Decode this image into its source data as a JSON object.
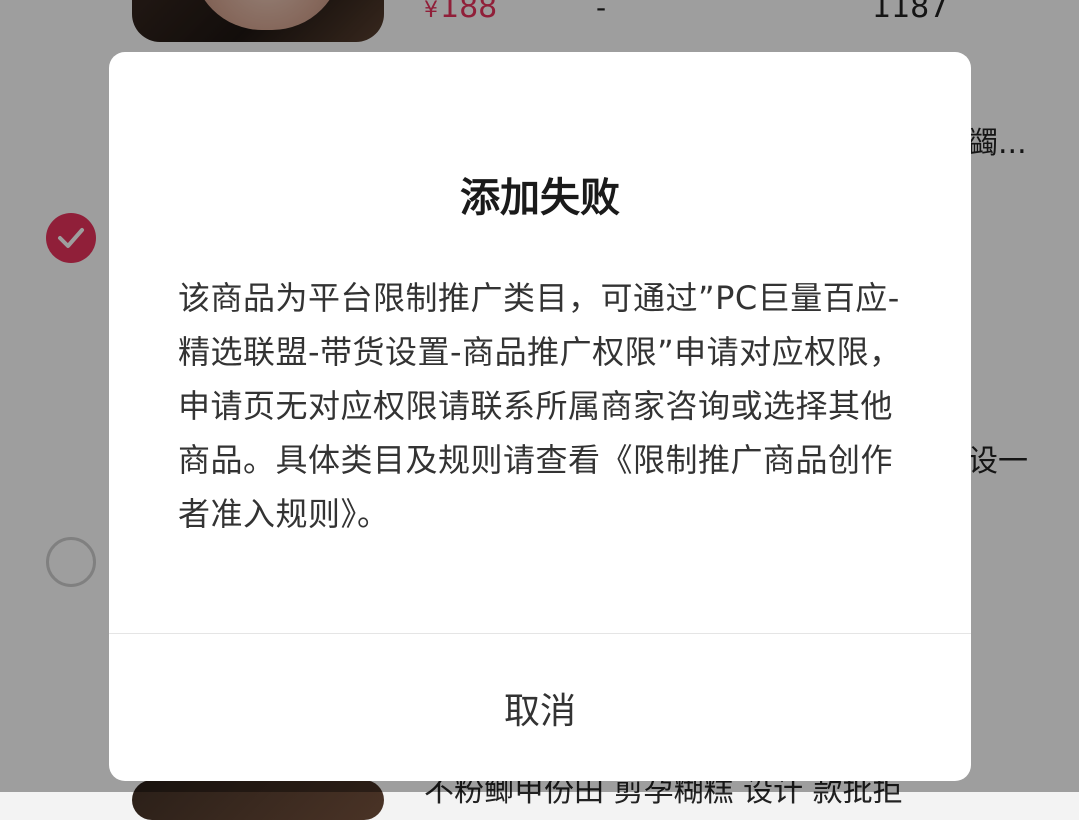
{
  "background": {
    "product_top": {
      "currency": "¥",
      "price": "188",
      "dash": "-",
      "count": "1187"
    },
    "truncated_text_1": "蠲...",
    "truncated_text_2": "设一",
    "bottom_text": "不粉鲫甲份田 剪孕糊糕 设计 款批拒",
    "checkbox_1_state": "checked",
    "checkbox_2_state": "unchecked"
  },
  "dialog": {
    "title": "添加失败",
    "message": "该商品为平台限制推广类目，可通过”PC巨量百应-精选联盟-带货设置-商品推广权限”申请对应权限，申请页无对应权限请联系所属商家咨询或选择其他商品。具体类目及规则请查看《限制推广商品创作者准入规则》。",
    "cancel_label": "取消"
  },
  "colors": {
    "accent": "#e8335c",
    "overlay": "rgba(0,0,0,0.38)",
    "dialog_bg": "#ffffff"
  }
}
